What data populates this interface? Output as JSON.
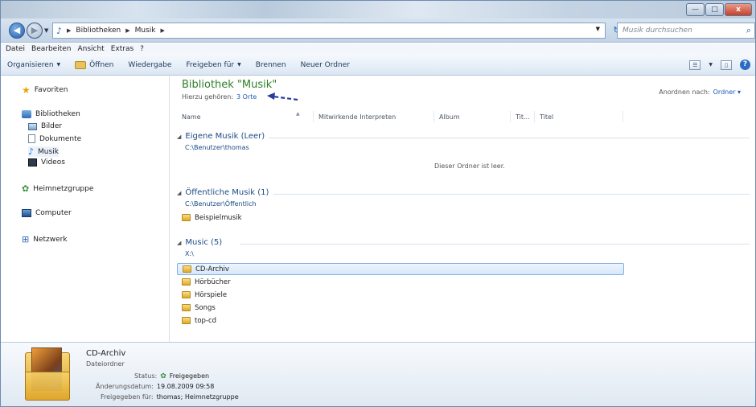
{
  "window": {
    "controls": {
      "minimize": "—",
      "maximize": "□",
      "close": "x"
    }
  },
  "address": {
    "crumbs": [
      "Bibliotheken",
      "Musik"
    ],
    "search_placeholder": "Musik durchsuchen"
  },
  "menu": [
    "Datei",
    "Bearbeiten",
    "Ansicht",
    "Extras",
    "?"
  ],
  "toolbar": {
    "organize": "Organisieren",
    "open": "Öffnen",
    "play": "Wiedergabe",
    "share": "Freigeben für",
    "burn": "Brennen",
    "new_folder": "Neuer Ordner"
  },
  "nav": {
    "favorites": "Favoriten",
    "libraries": "Bibliotheken",
    "lib_items": [
      "Bilder",
      "Dokumente",
      "Musik",
      "Videos"
    ],
    "homegroup": "Heimnetzgruppe",
    "computer": "Computer",
    "network": "Netzwerk"
  },
  "library": {
    "title": "Bibliothek \"Musik\"",
    "includes_label": "Hierzu gehören:",
    "includes_link": "3 Orte",
    "arrange_label": "Anordnen nach:",
    "arrange_value": "Ordner"
  },
  "columns": [
    "Name",
    "Mitwirkende Interpreten",
    "Album",
    "Tit...",
    "Titel"
  ],
  "groups": [
    {
      "title": "Eigene Musik (Leer)",
      "path": "C:\\Benutzer\\thomas",
      "empty_msg": "Dieser Ordner ist leer.",
      "items": []
    },
    {
      "title": "Öffentliche Musik (1)",
      "path": "C:\\Benutzer\\Öffentlich",
      "items": [
        "Beispielmusik"
      ]
    },
    {
      "title": "Music (5)",
      "path": "X:\\",
      "items": [
        "CD-Archiv",
        "Hörbücher",
        "Hörspiele",
        "Songs",
        "top-cd"
      ]
    }
  ],
  "details": {
    "name": "CD-Archiv",
    "type": "Dateiordner",
    "status_label": "Status:",
    "status_value": "Freigegeben",
    "date_label": "Änderungsdatum:",
    "date_value": "19.08.2009 09:58",
    "shared_label": "Freigegeben für:",
    "shared_value": "thomas; Heimnetzgruppe"
  }
}
